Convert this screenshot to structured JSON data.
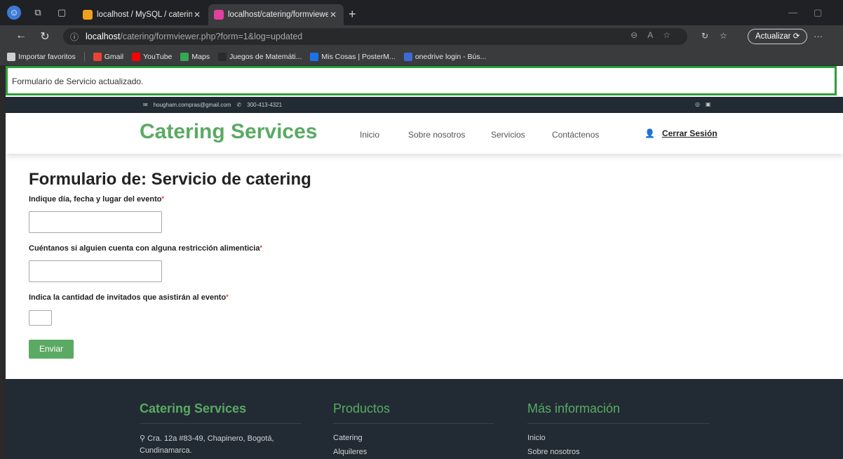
{
  "browser": {
    "tabs": [
      {
        "title": "localhost / MySQL / cateringdb /"
      },
      {
        "title": "localhost/catering/formviewer.ph"
      }
    ],
    "address": {
      "host": "localhost",
      "path": "/catering/formviewer.php?form=1&log=updated"
    },
    "update_label": "Actualizar",
    "bookmarks": [
      {
        "label": "Importar favoritos",
        "color": "#cfcfcf"
      },
      {
        "label": "Gmail",
        "color": "#ea4335"
      },
      {
        "label": "YouTube",
        "color": "#ff0000"
      },
      {
        "label": "Maps",
        "color": "#34a853"
      },
      {
        "label": "Juegos de Matemáti...",
        "color": "#2b2b2b"
      },
      {
        "label": "Mis Cosas | PosterM...",
        "color": "#1a73e8"
      },
      {
        "label": "onedrive login - Bús...",
        "color": "#3d6bd6"
      }
    ]
  },
  "notice": {
    "text": "Formulario de Servicio actualizado."
  },
  "topbar": {
    "email": "hougham.compras@gmail.com",
    "phone": "300-413-4321"
  },
  "header": {
    "brand": "Catering Services",
    "nav": [
      "Inicio",
      "Sobre nosotros",
      "Servicios",
      "Contáctenos"
    ],
    "logout": "Cerrar Sesión"
  },
  "form": {
    "title": "Formulario de: Servicio de catering",
    "questions": [
      {
        "label": "Indique día, fecha y lugar del evento",
        "value": ""
      },
      {
        "label": "Cuéntanos si alguien cuenta con alguna restricción alimenticia",
        "value": ""
      },
      {
        "label": "Indica la cantidad de invitados que asistirán al evento",
        "value": ""
      }
    ],
    "submit": "Enviar"
  },
  "footer": {
    "brand": "Catering Services",
    "address": "Cra. 12a #83-49, Chapinero, Bogotá,",
    "address2": "Cundinamarca.",
    "products_title": "Productos",
    "products": [
      "Catering",
      "Alquileres"
    ],
    "info_title": "Más información",
    "info": [
      "Inicio",
      "Sobre nosotros"
    ]
  },
  "colors": {
    "brand_green": "#5aaa64",
    "dark": "#222b33",
    "notice_border": "#2e9e3a"
  }
}
